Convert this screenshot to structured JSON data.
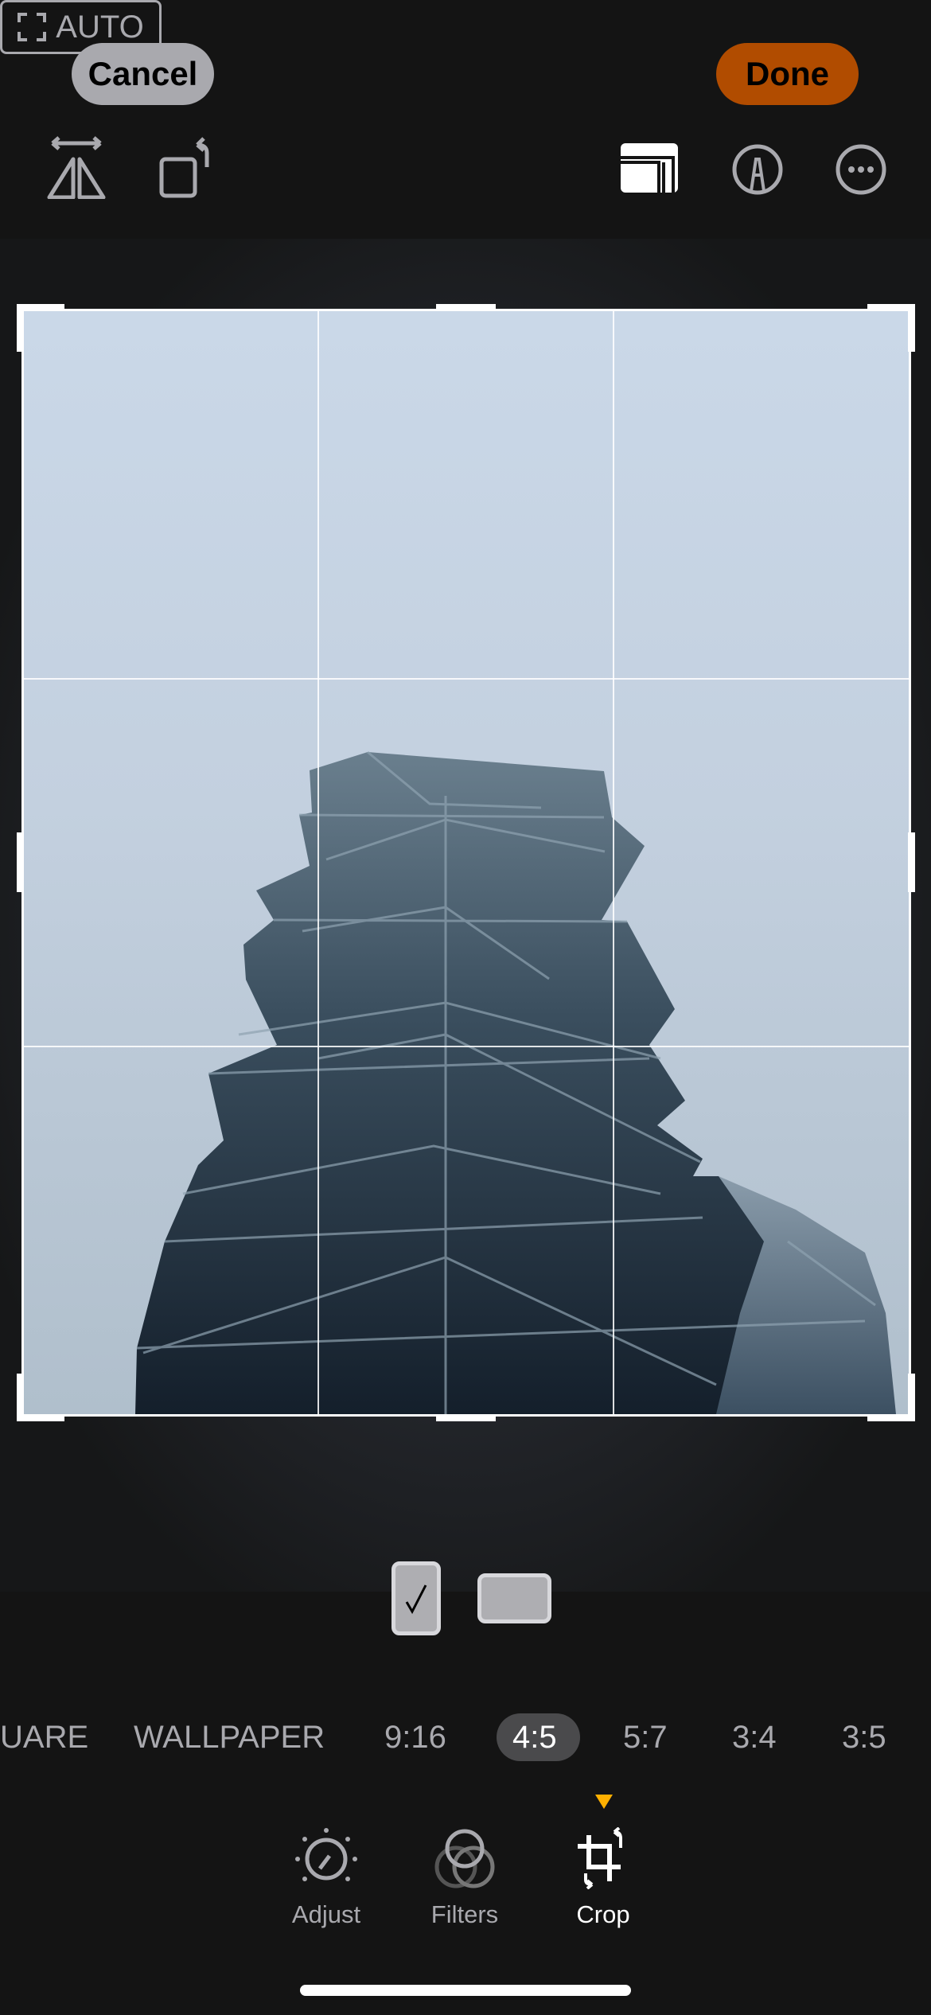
{
  "header": {
    "cancel_label": "Cancel",
    "done_label": "Done",
    "auto_label": "AUTO"
  },
  "colors": {
    "done": "#b14c00",
    "cancel": "#a9a9ae",
    "indicator": "#ffb000"
  },
  "toolbar_icons": [
    "flip-horizontal-icon",
    "rotate-icon",
    "auto-crop-icon",
    "aspect-ratio-icon",
    "markup-icon",
    "more-icon"
  ],
  "orientation": {
    "options": [
      "portrait",
      "landscape"
    ],
    "selected": "portrait"
  },
  "aspect_ratios": {
    "items": [
      "SQUARE",
      "WALLPAPER",
      "9:16",
      "4:5",
      "5:7",
      "3:4",
      "3:5"
    ],
    "visible_partial_first": "UARE",
    "selected": "4:5"
  },
  "tools": [
    {
      "label": "Adjust",
      "icon": "adjust-dial-icon"
    },
    {
      "label": "Filters",
      "icon": "filters-icon"
    },
    {
      "label": "Crop",
      "icon": "crop-rotate-icon",
      "active": true
    }
  ]
}
